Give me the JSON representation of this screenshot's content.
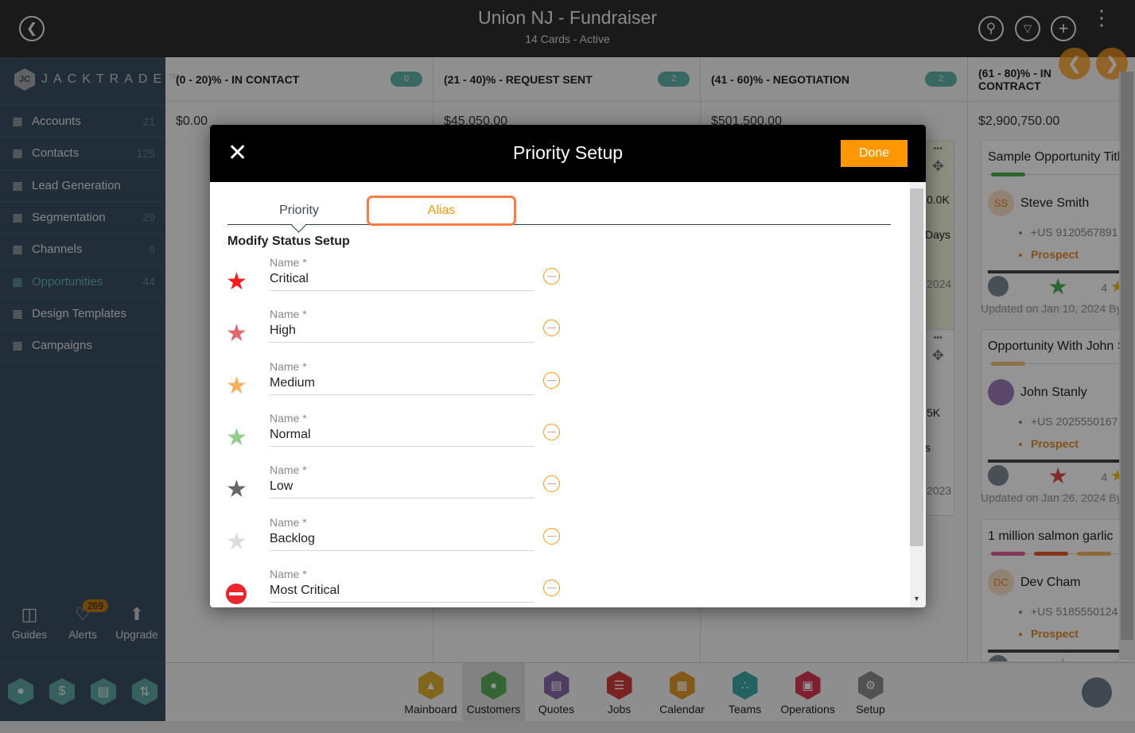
{
  "header": {
    "title": "Union NJ - Fundraiser",
    "subtitle": "14 Cards - Active"
  },
  "sidebar": {
    "logo": "JACKTRADE™",
    "items": [
      {
        "label": "Accounts",
        "count": "21",
        "icon": "building-icon"
      },
      {
        "label": "Contacts",
        "count": "125",
        "icon": "contacts-icon"
      },
      {
        "label": "Lead Generation",
        "count": "",
        "icon": "lead-icon"
      },
      {
        "label": "Segmentation",
        "count": "29",
        "icon": "segmentation-icon"
      },
      {
        "label": "Channels",
        "count": "9",
        "icon": "channels-icon"
      },
      {
        "label": "Opportunities",
        "count": "44",
        "icon": "opportunities-icon",
        "active": true
      },
      {
        "label": "Design Templates",
        "count": "",
        "icon": "templates-icon"
      },
      {
        "label": "Campaigns",
        "count": "",
        "icon": "campaigns-icon"
      }
    ],
    "utilities": [
      {
        "label": "Guides"
      },
      {
        "label": "Alerts",
        "badge": "269"
      },
      {
        "label": "Upgrade"
      }
    ]
  },
  "board": {
    "columns": [
      {
        "title": "(0 - 20)% - IN CONTACT",
        "count": "0",
        "amount": "$0.00"
      },
      {
        "title": "(21 - 40)% - REQUEST SENT",
        "count": "2",
        "amount": "$45,050.00"
      },
      {
        "title": "(41 - 60)% - NEGOTIATION",
        "count": "2",
        "amount": "$501,500.00"
      },
      {
        "title": "(61 - 80)% - IN CONTRACT",
        "count": "",
        "amount": "$2,900,750.00"
      }
    ],
    "partial": [
      "0.0K",
      "Days",
      "2024",
      "5K",
      "s",
      "2023"
    ],
    "cards": [
      {
        "title": "Sample Opportunity Title",
        "initials": "SS",
        "name": "Steve Smith",
        "phone": "+US 9120567891",
        "status": "Prospect",
        "count": "4",
        "updated": "Updated on Jan 10, 2024 By"
      },
      {
        "title": "Opportunity With John S",
        "initials": "",
        "name": "John Stanly",
        "phone": "+US 2025550167",
        "status": "Prospect",
        "count": "4",
        "updated": "Updated on Jan 26, 2024 By"
      },
      {
        "title": "1 million salmon garlic",
        "initials": "DC",
        "name": "Dev Cham",
        "phone": "+US 5185550124",
        "status": "Prospect"
      }
    ]
  },
  "bottom_nav": [
    {
      "label": "Mainboard",
      "color": "#e0b030"
    },
    {
      "label": "Customers",
      "color": "#5cac5c",
      "active": true
    },
    {
      "label": "Quotes",
      "color": "#8a6aac"
    },
    {
      "label": "Jobs",
      "color": "#d23c3c"
    },
    {
      "label": "Calendar",
      "color": "#e09a28"
    },
    {
      "label": "Teams",
      "color": "#3fa8a8"
    },
    {
      "label": "Operations",
      "color": "#d83a55"
    },
    {
      "label": "Setup",
      "color": "#8c8c8c"
    }
  ],
  "modal": {
    "title": "Priority Setup",
    "done_label": "Done",
    "tabs": [
      "Priority",
      "Alias"
    ],
    "active_tab": "Priority",
    "highlighted_tab": "Alias",
    "section": "Modify Status Setup",
    "field_label": "Name *",
    "priorities": [
      {
        "name": "Critical",
        "color": "#ff1a1a"
      },
      {
        "name": "High",
        "color": "#e06a6a"
      },
      {
        "name": "Medium",
        "color": "#f7b05a"
      },
      {
        "name": "Normal",
        "color": "#8fcf8a"
      },
      {
        "name": "Low",
        "color": "#666666"
      },
      {
        "name": "Backlog",
        "color": "#dddddd"
      },
      {
        "name": "Most Critical",
        "color": "#e8262b",
        "icon": "no-entry-icon"
      }
    ]
  }
}
